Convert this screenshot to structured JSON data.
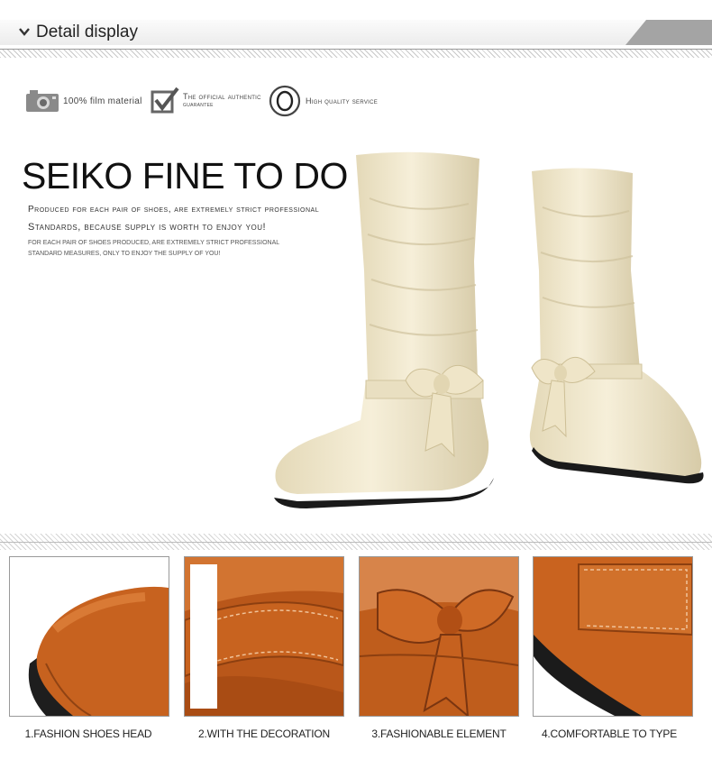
{
  "header": {
    "title": "Detail display",
    "icon": "chevron-down-icon"
  },
  "features": [
    {
      "icon": "camera-icon",
      "text": "100% film material"
    },
    {
      "icon": "checkmark-icon",
      "text_line1": "The official authentic",
      "text_line2": "guarantee"
    },
    {
      "icon": "circle-o-icon",
      "text": "High quality service"
    }
  ],
  "hero": {
    "title": "SEIKO FINE TO DO",
    "line1": "Produced for each pair of shoes, are extremely strict professional",
    "line2": "Standards, because supply is worth to enjoy you!",
    "line3": "FOR EACH PAIR OF SHOES PRODUCED, ARE EXTREMELY STRICT PROFESSIONAL",
    "line4": "STANDARD MEASURES, ONLY TO ENJOY THE SUPPLY OF YOU!"
  },
  "details": [
    {
      "caption": "1.FASHION SHOES HEAD"
    },
    {
      "caption": "2.WITH THE DECORATION"
    },
    {
      "caption": "3.FASHIONABLE ELEMENT"
    },
    {
      "caption": "4.COMFORTABLE TO TYPE"
    }
  ],
  "colors": {
    "boot_beige": "#efe6cc",
    "leather_brown": "#c9631f",
    "sole": "#1a1a1a"
  }
}
